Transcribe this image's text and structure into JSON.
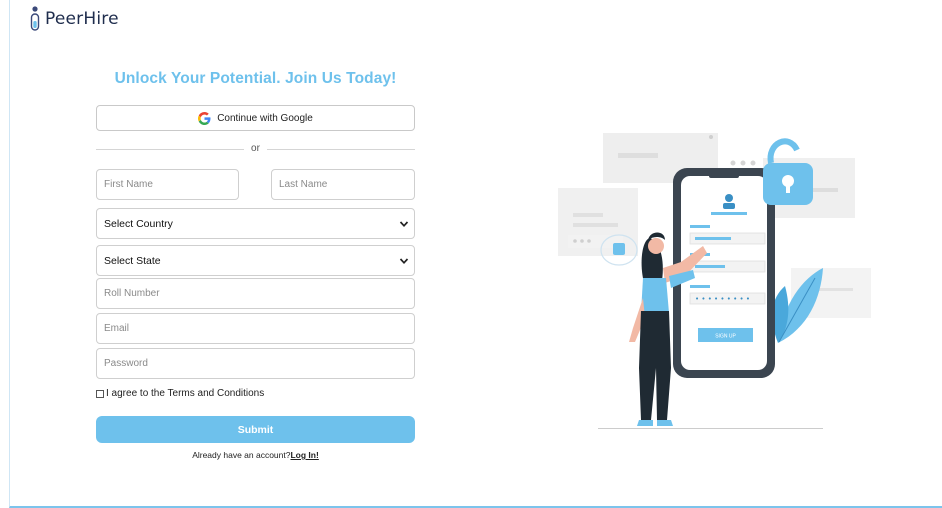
{
  "brand": {
    "name": "PeerHire"
  },
  "form": {
    "heading": "Unlock Your Potential. Join Us Today!",
    "google_button": "Continue with Google",
    "divider_text": "or",
    "first_name_placeholder": "First Name",
    "last_name_placeholder": "Last Name",
    "country_select": "Select Country",
    "state_select": "Select State",
    "roll_number_placeholder": "Roll Number",
    "email_placeholder": "Email",
    "password_placeholder": "Password",
    "terms_label": "I agree to the Terms and Conditions",
    "submit_label": "Submit",
    "login_prompt": "Already have an account?",
    "login_link": "Log In!"
  },
  "illustration": {
    "button_text": "SIGN UP"
  },
  "colors": {
    "accent": "#6ec1ec",
    "brand_text": "#1f2d4d"
  }
}
